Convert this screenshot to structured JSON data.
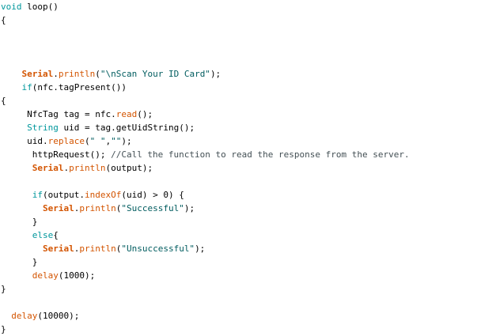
{
  "colors": {
    "keyword": "#00979c",
    "object": "#d35400",
    "function": "#d35400",
    "string": "#005c5f",
    "comment": "#434f54",
    "plain": "#000000",
    "background": "#ffffff"
  },
  "lines": [
    [
      {
        "t": "void",
        "c": "kw"
      },
      {
        "t": " loop()",
        "c": "plain"
      }
    ],
    [
      {
        "t": "{",
        "c": "plain"
      }
    ],
    [],
    [],
    [],
    [
      {
        "t": "    ",
        "c": "plain"
      },
      {
        "t": "Serial",
        "c": "obj"
      },
      {
        "t": ".",
        "c": "plain"
      },
      {
        "t": "println",
        "c": "fn"
      },
      {
        "t": "(",
        "c": "plain"
      },
      {
        "t": "\"\\nScan Your ID Card\"",
        "c": "str"
      },
      {
        "t": ");",
        "c": "plain"
      }
    ],
    [
      {
        "t": "    ",
        "c": "plain"
      },
      {
        "t": "if",
        "c": "kw"
      },
      {
        "t": "(nfc.tagPresent())",
        "c": "plain"
      }
    ],
    [
      {
        "t": "{",
        "c": "plain"
      }
    ],
    [
      {
        "t": "     NfcTag tag = nfc.",
        "c": "plain"
      },
      {
        "t": "read",
        "c": "fn"
      },
      {
        "t": "();",
        "c": "plain"
      }
    ],
    [
      {
        "t": "     ",
        "c": "plain"
      },
      {
        "t": "String",
        "c": "kw"
      },
      {
        "t": " uid = tag.getUidString();",
        "c": "plain"
      }
    ],
    [
      {
        "t": "     uid.",
        "c": "plain"
      },
      {
        "t": "replace",
        "c": "fn"
      },
      {
        "t": "(",
        "c": "plain"
      },
      {
        "t": "\" \"",
        "c": "str"
      },
      {
        "t": ",",
        "c": "plain"
      },
      {
        "t": "\"\"",
        "c": "str"
      },
      {
        "t": ");",
        "c": "plain"
      }
    ],
    [
      {
        "t": "      httpRequest(); ",
        "c": "plain"
      },
      {
        "t": "//Call the function to read the response from the server.",
        "c": "cmt"
      }
    ],
    [
      {
        "t": "      ",
        "c": "plain"
      },
      {
        "t": "Serial",
        "c": "obj"
      },
      {
        "t": ".",
        "c": "plain"
      },
      {
        "t": "println",
        "c": "fn"
      },
      {
        "t": "(output);",
        "c": "plain"
      }
    ],
    [],
    [
      {
        "t": "      ",
        "c": "plain"
      },
      {
        "t": "if",
        "c": "kw"
      },
      {
        "t": "(output.",
        "c": "plain"
      },
      {
        "t": "indexOf",
        "c": "fn"
      },
      {
        "t": "(uid) > 0) {",
        "c": "plain"
      }
    ],
    [
      {
        "t": "        ",
        "c": "plain"
      },
      {
        "t": "Serial",
        "c": "obj"
      },
      {
        "t": ".",
        "c": "plain"
      },
      {
        "t": "println",
        "c": "fn"
      },
      {
        "t": "(",
        "c": "plain"
      },
      {
        "t": "\"Successful\"",
        "c": "str"
      },
      {
        "t": ");",
        "c": "plain"
      }
    ],
    [
      {
        "t": "      }",
        "c": "plain"
      }
    ],
    [
      {
        "t": "      ",
        "c": "plain"
      },
      {
        "t": "else",
        "c": "kw"
      },
      {
        "t": "{",
        "c": "plain"
      }
    ],
    [
      {
        "t": "        ",
        "c": "plain"
      },
      {
        "t": "Serial",
        "c": "obj"
      },
      {
        "t": ".",
        "c": "plain"
      },
      {
        "t": "println",
        "c": "fn"
      },
      {
        "t": "(",
        "c": "plain"
      },
      {
        "t": "\"Unsuccessful\"",
        "c": "str"
      },
      {
        "t": ");",
        "c": "plain"
      }
    ],
    [
      {
        "t": "      }",
        "c": "plain"
      }
    ],
    [
      {
        "t": "      ",
        "c": "plain"
      },
      {
        "t": "delay",
        "c": "fn"
      },
      {
        "t": "(1000);",
        "c": "plain"
      }
    ],
    [
      {
        "t": "}",
        "c": "plain"
      }
    ],
    [],
    [
      {
        "t": "  ",
        "c": "plain"
      },
      {
        "t": "delay",
        "c": "fn"
      },
      {
        "t": "(10000);",
        "c": "plain"
      }
    ],
    [
      {
        "t": "}",
        "c": "plain"
      }
    ]
  ]
}
